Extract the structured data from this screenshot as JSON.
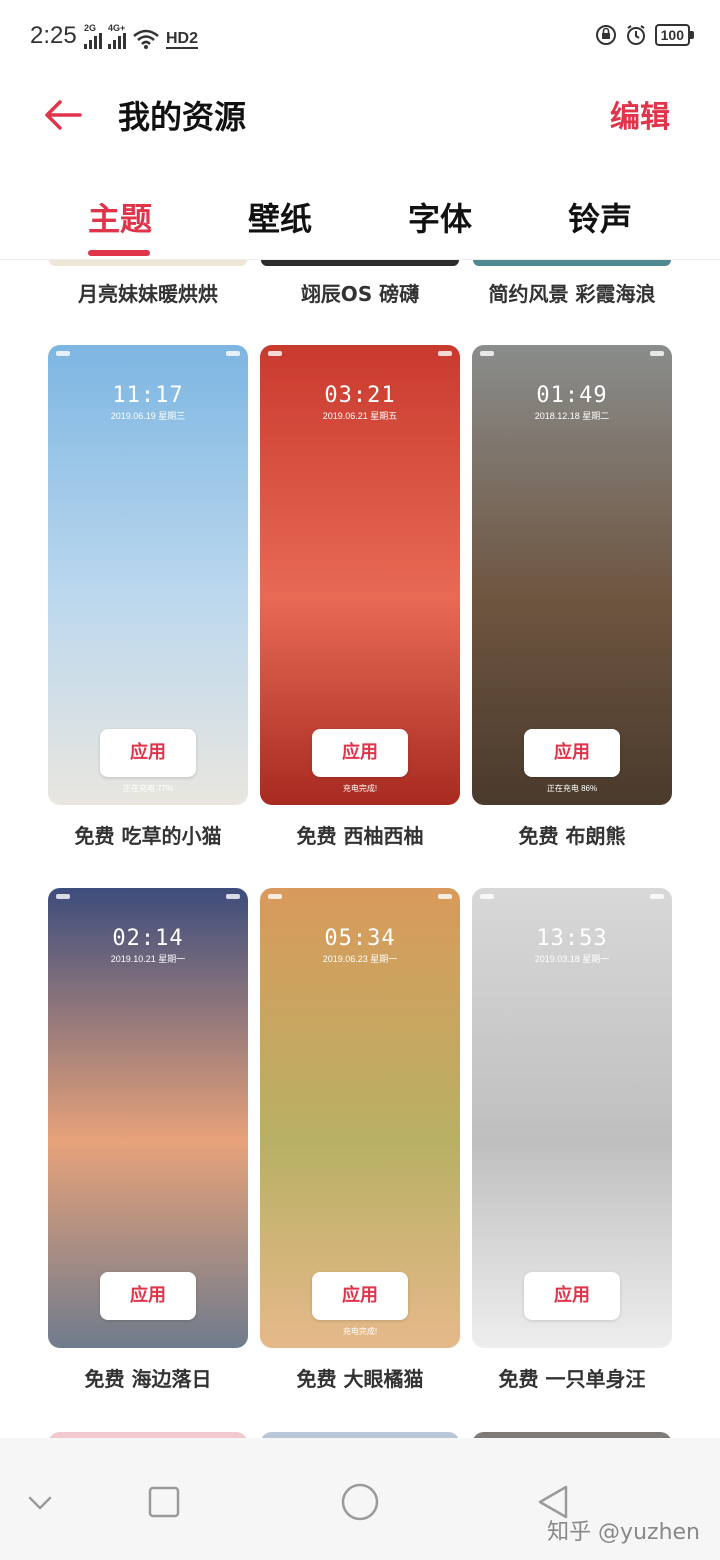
{
  "status_bar": {
    "time": "2:25",
    "signal1_label": "2G",
    "signal2_label": "4G+",
    "hd_label": "HD2",
    "battery": "100",
    "icons": [
      "signal-icon",
      "wifi-icon",
      "lock-rotation-icon",
      "alarm-icon",
      "battery-icon"
    ]
  },
  "header": {
    "title": "我的资源",
    "edit_label": "编辑",
    "back_icon": "back-arrow-icon"
  },
  "tabs": [
    {
      "label": "主题",
      "active": true
    },
    {
      "label": "壁纸",
      "active": false
    },
    {
      "label": "字体",
      "active": false
    },
    {
      "label": "铃声",
      "active": false
    }
  ],
  "top_row_labels": [
    "月亮妹妹暖烘烘",
    "翊辰OS 磅礴",
    "简约风景 彩霞海浪"
  ],
  "themes": [
    {
      "name": "免费 吃草的小猫",
      "clock": "11:17",
      "date": "2019.06.19 星期三",
      "caption": "正在充电 77%",
      "apply": "应用",
      "colors": [
        "#7db6e2",
        "#bcd8ee",
        "#e9e6df"
      ]
    },
    {
      "name": "免费 西柚西柚",
      "clock": "03:21",
      "date": "2019.06.21 星期五",
      "caption": "充电完成!",
      "apply": "应用",
      "colors": [
        "#c93a2e",
        "#e86a55",
        "#a82a20"
      ]
    },
    {
      "name": "免费 布朗熊",
      "clock": "01:49",
      "date": "2018.12.18 星期二",
      "caption": "正在充电 86%",
      "apply": "应用",
      "colors": [
        "#8a8d8c",
        "#6e5540",
        "#4a3a2c"
      ]
    },
    {
      "name": "免费 海边落日",
      "clock": "02:14",
      "date": "2019.10.21 星期一",
      "caption": "",
      "apply": "应用",
      "colors": [
        "#3d4d7c",
        "#e7a27a",
        "#6f7b8c"
      ]
    },
    {
      "name": "免费 大眼橘猫",
      "clock": "05:34",
      "date": "2019.06.23 星期一",
      "caption": "充电完成!",
      "apply": "应用",
      "colors": [
        "#d99a5c",
        "#b8b064",
        "#e6b98a"
      ]
    },
    {
      "name": "免费 一只单身汪",
      "clock": "13:53",
      "date": "2019.03.18 星期一",
      "caption": "",
      "apply": "应用",
      "colors": [
        "#d8d8d8",
        "#bfbfbf",
        "#eeeeee"
      ]
    }
  ],
  "bottom_row_colors": [
    "#f1c9cf",
    "#b9c6d6",
    "#7d7a78"
  ],
  "navbar": {
    "icons": [
      "chevron-down-icon",
      "recent-apps-icon",
      "home-icon",
      "back-triangle-icon"
    ],
    "watermark": "知乎 @yuzhen"
  },
  "accent_color": "#e0344a"
}
